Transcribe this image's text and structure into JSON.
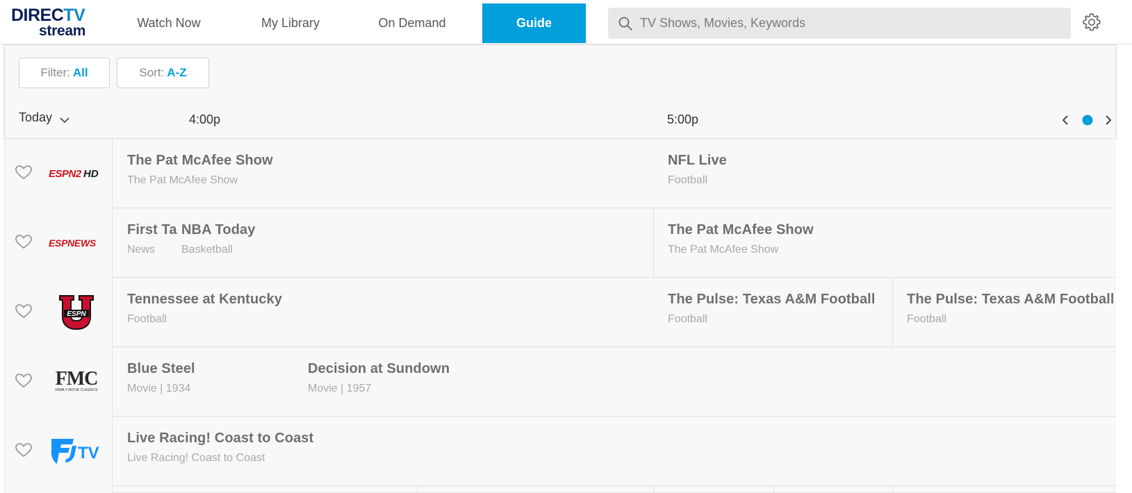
{
  "brand": {
    "line1": "DIRECTV",
    "line2": "stream",
    "tv_part": "TV"
  },
  "nav": {
    "tabs": [
      {
        "label": "Watch Now"
      },
      {
        "label": "My Library"
      },
      {
        "label": "On Demand"
      },
      {
        "label": "Guide",
        "active": true
      }
    ]
  },
  "search": {
    "placeholder": "TV Shows, Movies, Keywords",
    "value": ""
  },
  "icons": {
    "search": "search-icon",
    "settings": "gear-icon",
    "favorite": "heart-icon"
  },
  "colors": {
    "accent": "#009fdb",
    "brand_dark": "#0b1f56",
    "espn_red": "#d0121b"
  },
  "filters": {
    "filter_label": "Filter:",
    "filter_value": "All",
    "sort_label": "Sort:",
    "sort_value": "A-Z"
  },
  "timebar": {
    "day": "Today",
    "times": [
      "4:00p",
      "5:00p"
    ]
  },
  "channels": [
    {
      "logo": "ESPN2HD",
      "programs": [
        {
          "title": "The Pat McAfee Show",
          "subtitle": "The Pat McAfee Show"
        },
        {
          "title": "NFL Live",
          "subtitle": "Football"
        }
      ]
    },
    {
      "logo": "ESPNEWS",
      "programs": [
        {
          "title": "First Ta",
          "subtitle": "News"
        },
        {
          "title": "NBA Today",
          "subtitle": "Basketball"
        },
        {
          "title": "The Pat McAfee Show",
          "subtitle": "The Pat McAfee Show"
        }
      ]
    },
    {
      "logo": "ESPN U",
      "programs": [
        {
          "title": "Tennessee at Kentucky",
          "subtitle": "Football"
        },
        {
          "title": "The Pulse: Texas A&M Football",
          "subtitle": "Football"
        },
        {
          "title": "The Pulse: Texas A&M Football",
          "subtitle": "Football"
        }
      ]
    },
    {
      "logo": "FMC",
      "logo_sub": "FAMILY MOVIE CLASSICS",
      "programs": [
        {
          "title": "Blue Steel",
          "subtitle": "Movie | 1934"
        },
        {
          "title": "Decision at Sundown",
          "subtitle": "Movie | 1957"
        }
      ]
    },
    {
      "logo": "FTV",
      "logo_text": "TV",
      "programs": [
        {
          "title": "Live Racing! Coast to Coast",
          "subtitle": "Live Racing! Coast to Coast"
        }
      ]
    }
  ]
}
